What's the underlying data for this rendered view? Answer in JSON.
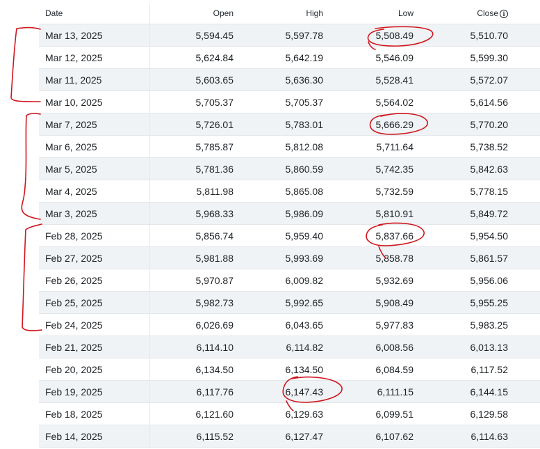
{
  "table": {
    "headers": {
      "date": "Date",
      "open": "Open",
      "high": "High",
      "low": "Low",
      "close": "Close"
    },
    "rows": [
      {
        "date": "Mar 13, 2025",
        "open": "5,594.45",
        "high": "5,597.78",
        "low": "5,508.49",
        "close": "5,510.70"
      },
      {
        "date": "Mar 12, 2025",
        "open": "5,624.84",
        "high": "5,642.19",
        "low": "5,546.09",
        "close": "5,599.30"
      },
      {
        "date": "Mar 11, 2025",
        "open": "5,603.65",
        "high": "5,636.30",
        "low": "5,528.41",
        "close": "5,572.07"
      },
      {
        "date": "Mar 10, 2025",
        "open": "5,705.37",
        "high": "5,705.37",
        "low": "5,564.02",
        "close": "5,614.56"
      },
      {
        "date": "Mar 7, 2025",
        "open": "5,726.01",
        "high": "5,783.01",
        "low": "5,666.29",
        "close": "5,770.20"
      },
      {
        "date": "Mar 6, 2025",
        "open": "5,785.87",
        "high": "5,812.08",
        "low": "5,711.64",
        "close": "5,738.52"
      },
      {
        "date": "Mar 5, 2025",
        "open": "5,781.36",
        "high": "5,860.59",
        "low": "5,742.35",
        "close": "5,842.63"
      },
      {
        "date": "Mar 4, 2025",
        "open": "5,811.98",
        "high": "5,865.08",
        "low": "5,732.59",
        "close": "5,778.15"
      },
      {
        "date": "Mar 3, 2025",
        "open": "5,968.33",
        "high": "5,986.09",
        "low": "5,810.91",
        "close": "5,849.72"
      },
      {
        "date": "Feb 28, 2025",
        "open": "5,856.74",
        "high": "5,959.40",
        "low": "5,837.66",
        "close": "5,954.50"
      },
      {
        "date": "Feb 27, 2025",
        "open": "5,981.88",
        "high": "5,993.69",
        "low": "5,858.78",
        "close": "5,861.57"
      },
      {
        "date": "Feb 26, 2025",
        "open": "5,970.87",
        "high": "6,009.82",
        "low": "5,932.69",
        "close": "5,956.06"
      },
      {
        "date": "Feb 25, 2025",
        "open": "5,982.73",
        "high": "5,992.65",
        "low": "5,908.49",
        "close": "5,955.25"
      },
      {
        "date": "Feb 24, 2025",
        "open": "6,026.69",
        "high": "6,043.65",
        "low": "5,977.83",
        "close": "5,983.25"
      },
      {
        "date": "Feb 21, 2025",
        "open": "6,114.10",
        "high": "6,114.82",
        "low": "6,008.56",
        "close": "6,013.13"
      },
      {
        "date": "Feb 20, 2025",
        "open": "6,134.50",
        "high": "6,134.50",
        "low": "6,084.59",
        "close": "6,117.52"
      },
      {
        "date": "Feb 19, 2025",
        "open": "6,117.76",
        "high": "6,147.43",
        "low": "6,111.15",
        "close": "6,144.15"
      },
      {
        "date": "Feb 18, 2025",
        "open": "6,121.60",
        "high": "6,129.63",
        "low": "6,099.51",
        "close": "6,129.58"
      },
      {
        "date": "Feb 14, 2025",
        "open": "6,115.52",
        "high": "6,127.47",
        "low": "6,107.62",
        "close": "6,114.63"
      }
    ]
  },
  "icons": {
    "close_info": "info-icon",
    "close_info_glyph": "i"
  },
  "annotations": {
    "color": "#d0161e",
    "brackets": [
      {
        "name": "bracket-week-mar-10-13",
        "rows": [
          "Mar 13, 2025",
          "Mar 10, 2025"
        ]
      },
      {
        "name": "bracket-week-mar-3-7",
        "rows": [
          "Mar 7, 2025",
          "Mar 3, 2025"
        ]
      },
      {
        "name": "bracket-week-feb-24-28",
        "rows": [
          "Feb 28, 2025",
          "Feb 24, 2025"
        ]
      }
    ],
    "circled_values": [
      {
        "name": "circle-low-mar-13",
        "value": "5,508.49"
      },
      {
        "name": "circle-low-mar-7",
        "value": "5,666.29"
      },
      {
        "name": "circle-low-feb-28",
        "value": "5,837.66"
      },
      {
        "name": "circle-high-feb-19",
        "value": "6,147.43"
      }
    ]
  }
}
